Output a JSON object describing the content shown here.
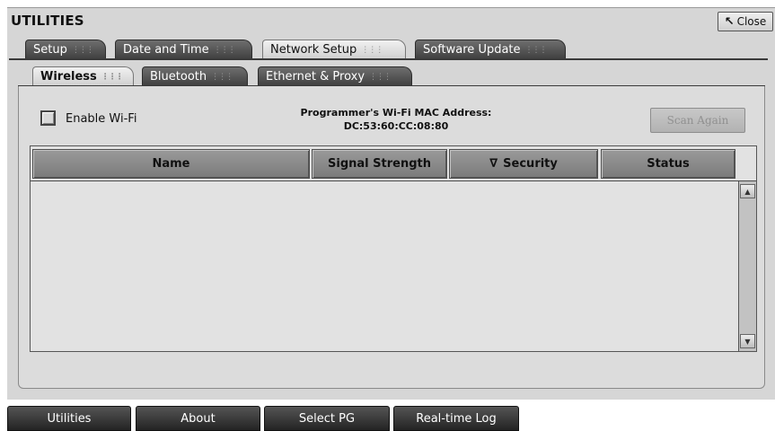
{
  "window": {
    "title": "UTILITIES",
    "close_label": "Close"
  },
  "main_tabs": [
    {
      "label": "Setup",
      "active": false
    },
    {
      "label": "Date and Time",
      "active": false
    },
    {
      "label": "Network Setup",
      "active": true
    },
    {
      "label": "Software Update",
      "active": false
    }
  ],
  "sub_tabs": [
    {
      "label": "Wireless",
      "active": true
    },
    {
      "label": "Bluetooth",
      "active": false
    },
    {
      "label": "Ethernet & Proxy",
      "active": false
    }
  ],
  "wireless": {
    "enable_label": "Enable Wi-Fi",
    "enable_checked": false,
    "mac_label": "Programmer's Wi-Fi MAC Address:",
    "mac_value": "DC:53:60:CC:08:80",
    "scan_label": "Scan Again"
  },
  "table": {
    "columns": [
      "Name",
      "Signal Strength",
      "Security",
      "Status"
    ],
    "sort_indicator": "∇",
    "rows": []
  },
  "bottom_nav": [
    "Utilities",
    "About",
    "Select PG",
    "Real-time Log"
  ],
  "icons": {
    "close": "close-arrow-icon",
    "sort": "sort-descending-icon",
    "tab_grip": "grip-icon"
  },
  "colors": {
    "window_bg": "#d6d6d6",
    "tab_dark": "#4a4a4a",
    "tab_active": "#e4e4e4",
    "header": "#8c8c8c",
    "bottom_bar": "#333333"
  }
}
